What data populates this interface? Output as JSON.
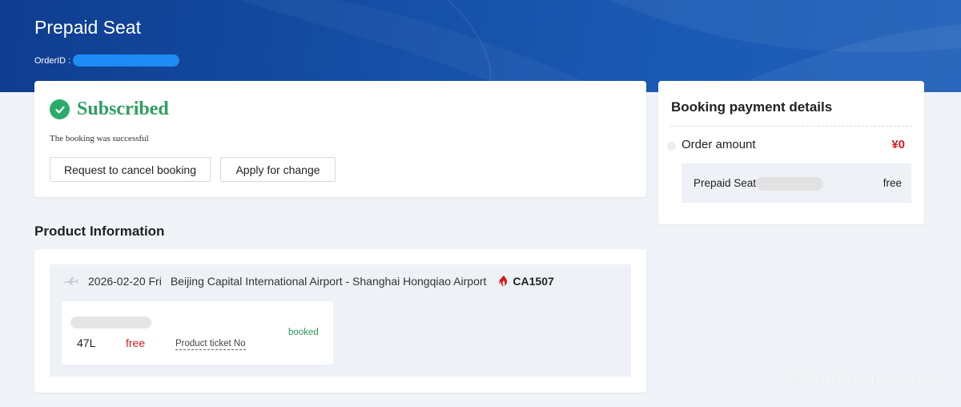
{
  "header": {
    "title": "Prepaid Seat",
    "order_id_label": "OrderID :"
  },
  "status": {
    "title": "Subscribed",
    "subtitle": "The booking was successful",
    "cancel_button": "Request to cancel booking",
    "change_button": "Apply for change",
    "color": "#2e9f5f"
  },
  "product": {
    "section_title": "Product Information",
    "flight": {
      "date": "2026-02-20 Fri",
      "route": "Beijing Capital International Airport - Shanghai Hongqiao Airport",
      "flight_no": "CA1507",
      "airline_icon": "air-china-logo-icon",
      "plane_icon": "plane-icon"
    },
    "ticket": {
      "seat": "47L",
      "price": "free",
      "ticket_link": "Product ticket No",
      "status": "booked"
    }
  },
  "payment": {
    "title": "Booking payment details",
    "order_amount_label": "Order amount",
    "order_amount_value": "¥0",
    "item_label": "Prepaid Seat",
    "item_value": "free",
    "accent_color": "#d81e1e"
  },
  "watermark": "© Flight-Report - jaersene",
  "colors": {
    "banner": "#154fa6",
    "background": "#f0f3f7",
    "redaction": "#1e8cf5"
  }
}
